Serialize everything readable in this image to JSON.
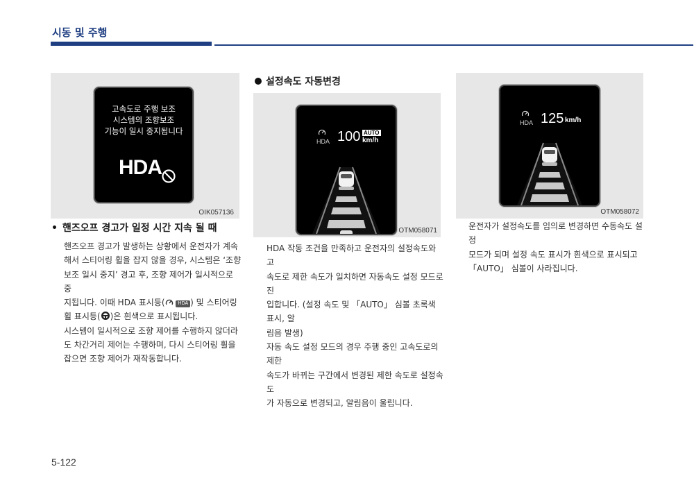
{
  "header": {
    "section_title": "시동 및 주행"
  },
  "figure_1": {
    "warning_lines": [
      "고속도로 주행 보조",
      "시스템의 조향보조",
      "기능이 일시 중지됩니다"
    ],
    "hda_label": "HDA",
    "icon": "hda-off-icon",
    "code": "OIK057136"
  },
  "figure_2": {
    "hda_label": "HDA",
    "speed": "100",
    "unit": "km/h",
    "auto_badge": "AUTO",
    "code": "OTM058071"
  },
  "figure_3": {
    "hda_label": "HDA",
    "speed": "125",
    "unit": "km/h",
    "code": "OTM058072"
  },
  "section_1": {
    "heading": "핸즈오프 경고가 일정 시간 지속 될 때",
    "lines": [
      "핸즈오프 경고가 발생하는 상황에서 운전자가 계속",
      "해서 스티어링 휠을 잡지 않을 경우, 시스템은 ‘조향",
      "보조 일시 중지’ 경고 후, 조향 제어가 일시적으로 중",
      "지됩니다. 이때 HDA 표시등(",
      ") 및 스티어링",
      "휠 표시등(",
      ")은 흰색으로 표시됩니다.",
      "시스템이 일시적으로 조향 제어를 수행하지 않더라",
      "도 차간거리 제어는 수행하며, 다시 스티어링 휠을",
      "잡으면 조향 제어가 재작동합니다."
    ],
    "inline_hda": "HDA"
  },
  "section_2": {
    "heading": "설정속도 자동변경",
    "lines": [
      "HDA 작동 조건을 만족하고 운전자의 설정속도와 고",
      "속도로 제한 속도가 일치하면 자동속도 설정 모드로 진",
      "입합니다. (설정 속도 및 「AUTO」 심볼 초록색 표시, 알",
      "림음 발생)",
      "자동 속도 설정 모드의 경우 주행 중인 고속도로의 제한",
      "속도가 바뀌는 구간에서 변경된 제한 속도로 설정속도",
      "가 자동으로 변경되고, 알림음이 울립니다."
    ]
  },
  "section_3": {
    "lines": [
      "운전자가 설정속도를 임의로 변경하면 수동속도 설정",
      "모드가 되며 설정 속도 표시가 흰색으로 표시되고",
      "「AUTO」 심볼이 사라집니다."
    ]
  },
  "footer": {
    "page_number": "5-122"
  },
  "colors": {
    "accent": "#1f3f82"
  }
}
